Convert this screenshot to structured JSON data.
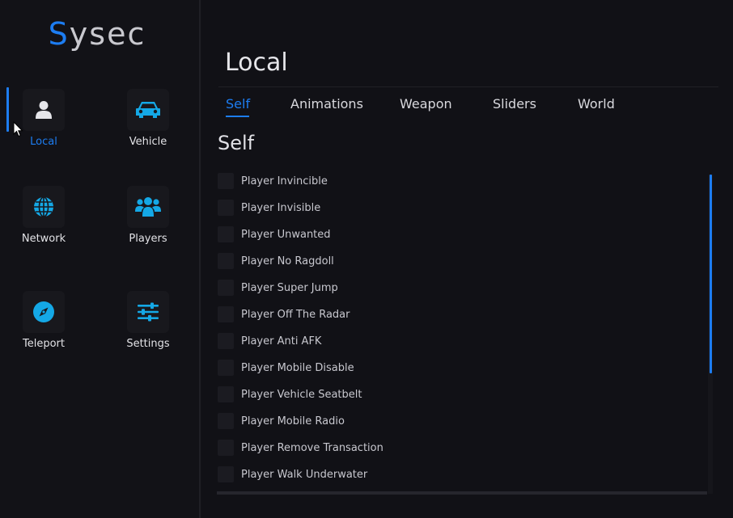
{
  "app": {
    "logo_first": "S",
    "logo_rest": "ysec",
    "accent_color": "#1d7df2"
  },
  "sidebar": {
    "items": [
      {
        "label": "Local",
        "icon": "user-icon",
        "active": true
      },
      {
        "label": "Vehicle",
        "icon": "car-icon",
        "active": false
      },
      {
        "label": "Network",
        "icon": "globe-icon",
        "active": false
      },
      {
        "label": "Players",
        "icon": "users-icon",
        "active": false
      },
      {
        "label": "Teleport",
        "icon": "compass-icon",
        "active": false
      },
      {
        "label": "Settings",
        "icon": "sliders-icon",
        "active": false
      }
    ]
  },
  "main": {
    "title": "Local",
    "tabs": [
      {
        "label": "Self",
        "active": true
      },
      {
        "label": "Animations",
        "active": false
      },
      {
        "label": "Weapon",
        "active": false
      },
      {
        "label": "Sliders",
        "active": false
      },
      {
        "label": "World",
        "active": false
      }
    ],
    "section_title": "Self",
    "options": [
      {
        "label": "Player Invincible",
        "checked": false
      },
      {
        "label": "Player Invisible",
        "checked": false
      },
      {
        "label": "Player Unwanted",
        "checked": false
      },
      {
        "label": "Player No Ragdoll",
        "checked": false
      },
      {
        "label": "Player Super Jump",
        "checked": false
      },
      {
        "label": "Player Off The Radar",
        "checked": false
      },
      {
        "label": "Player Anti AFK",
        "checked": false
      },
      {
        "label": "Player Mobile Disable",
        "checked": false
      },
      {
        "label": "Player Vehicle Seatbelt",
        "checked": false
      },
      {
        "label": "Player Mobile Radio",
        "checked": false
      },
      {
        "label": "Player Remove Transaction",
        "checked": false
      },
      {
        "label": "Player Walk Underwater",
        "checked": false
      }
    ]
  }
}
